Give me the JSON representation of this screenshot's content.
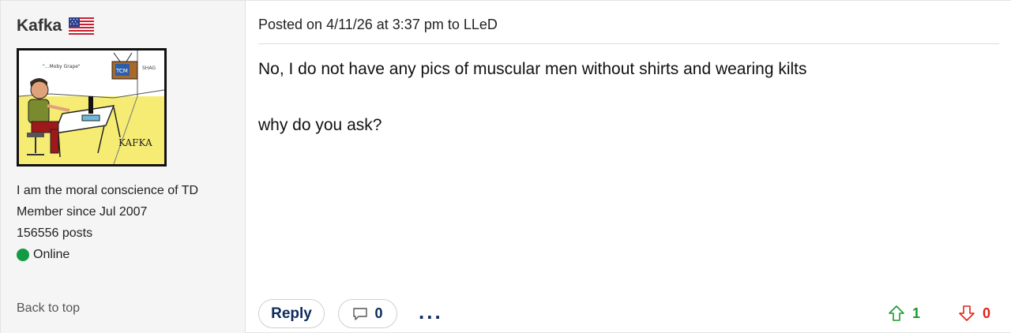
{
  "author": {
    "name": "Kafka",
    "flag_icon": "us-flag-icon",
    "tagline": "I am the moral conscience of TD",
    "member_since": "Member since Jul 2007",
    "post_count": "156556 posts",
    "status": "Online",
    "status_color": "#129a45",
    "avatar_text": {
      "caption": "\"...Moby Grape\"",
      "tv_label": "TCM",
      "scribble": "SHAG",
      "signature": "KAFKA"
    }
  },
  "post": {
    "meta": "Posted on 4/11/26 at 3:37 pm to LLeD",
    "paragraphs": [
      "No, I do not have any pics of muscular men without shirts and wearing kilts",
      "why do you ask?"
    ]
  },
  "actions": {
    "reply_label": "Reply",
    "comment_count": "0",
    "more_label": "...",
    "upvotes": "1",
    "downvotes": "0",
    "upvote_color": "#1a9a2c",
    "downvote_color": "#e0221b"
  },
  "sidebar": {
    "back_to_top": "Back to top"
  }
}
